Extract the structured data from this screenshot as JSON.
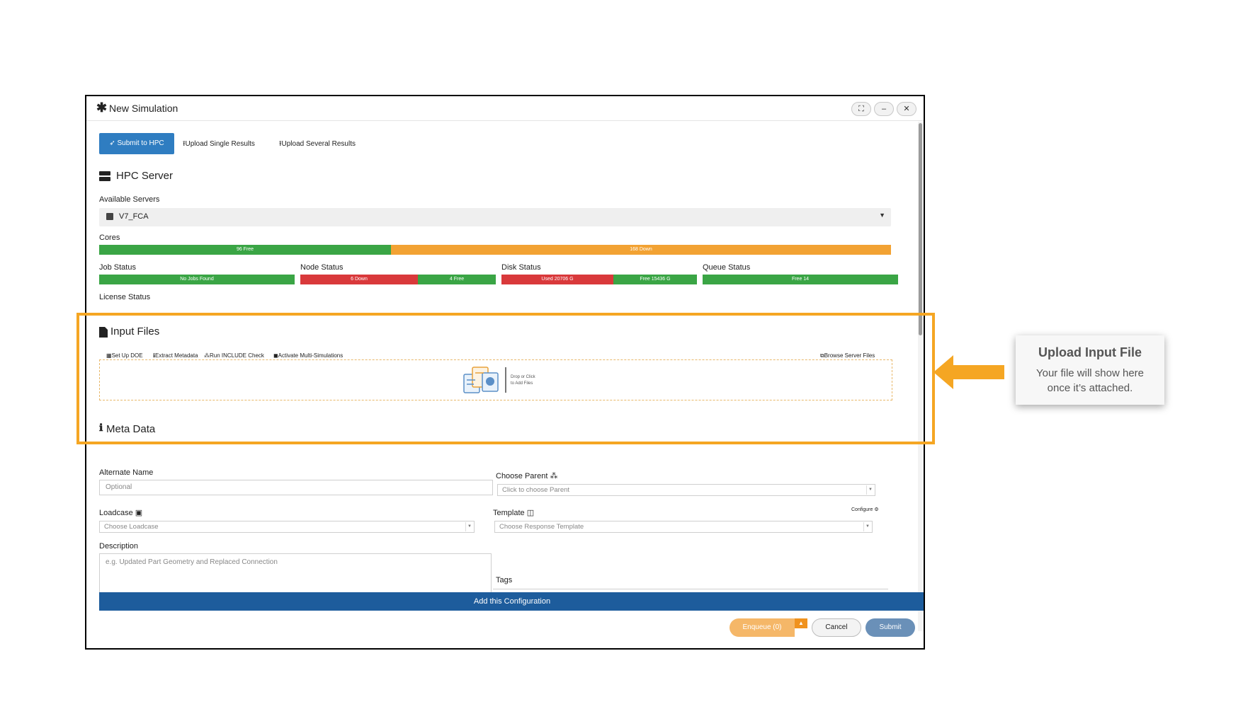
{
  "dialog": {
    "title": "New Simulation",
    "window_controls": [
      "expand-icon",
      "minimize-icon",
      "close-icon"
    ]
  },
  "tabs": [
    {
      "label": "Submit to HPC",
      "icon": "rocket-icon",
      "active": true
    },
    {
      "label": "Upload Single Results",
      "icon": "upload-icon",
      "active": false
    },
    {
      "label": "Upload Several Results",
      "icon": "upload-icon",
      "active": false
    }
  ],
  "hpc_server": {
    "title": "HPC Server",
    "available_servers_label": "Available Servers",
    "selected_server": "V7_FCA",
    "cores_label": "Cores",
    "cores_bars": [
      {
        "label": "96 Free",
        "color": "#3aa545"
      },
      {
        "label": "168 Down",
        "color": "#f2a233"
      }
    ],
    "job_status": {
      "label": "Job Status",
      "bar": "No Jobs Found"
    },
    "node_status": {
      "label": "Node Status",
      "down": "6 Down",
      "free": "4 Free"
    },
    "disk_status": {
      "label": "Disk Status",
      "used": "Used 20706 G",
      "free": "Free 15436 G"
    },
    "queue_status": {
      "label": "Queue Status",
      "bar": "Free 14"
    },
    "license_status_label": "License Status"
  },
  "input_files": {
    "title": "Input Files",
    "tools": [
      "Set Up DOE",
      "Extract Metadata",
      "Run INCLUDE Check",
      "Activate Multi-Simulations"
    ],
    "browse_label": "Browse Server Files",
    "dropzone_text_line1": "Drop or Click",
    "dropzone_text_line2": "to Add Files"
  },
  "meta_data": {
    "title": "Meta Data",
    "alternate_name_label": "Alternate Name",
    "alternate_name_placeholder": "Optional",
    "choose_parent_label": "Choose Parent",
    "choose_parent_placeholder": "Click to choose Parent",
    "loadcase_label": "Loadcase",
    "loadcase_placeholder": "Choose Loadcase",
    "template_label": "Template",
    "template_placeholder": "Choose Response Template",
    "configure_label": "Configure",
    "description_label": "Description",
    "description_placeholder": "e.g. Updated Part Geometry and Replaced Connection",
    "tags_label": "Tags"
  },
  "add_config_label": "Add this Configuration",
  "footer": {
    "enqueue_label": "Enqueue (0)",
    "cancel_label": "Cancel",
    "submit_label": "Submit"
  },
  "callout": {
    "title": "Upload Input File",
    "body": "Your file will show here once it’s attached.",
    "accent": "#f5a623"
  }
}
